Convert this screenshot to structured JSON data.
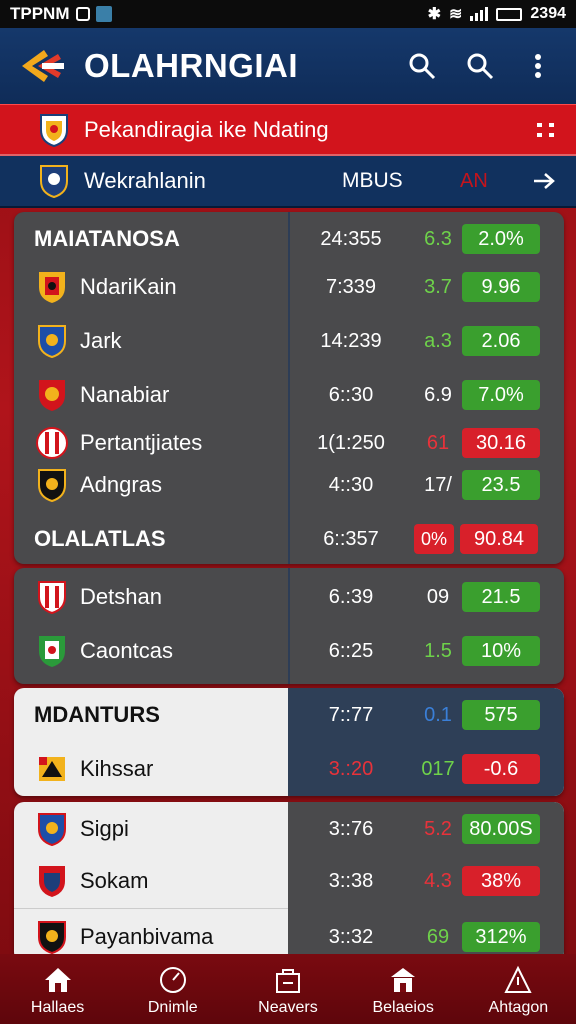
{
  "status_bar": {
    "left_text": "TPPNM",
    "time": "2394"
  },
  "app_bar": {
    "title": "OLAHRNGIAI"
  },
  "banner": {
    "text": "Pekandiragia ike Ndating"
  },
  "sub_banner": {
    "name": "Wekrahlanin",
    "col2": "MBUS",
    "col3": "AN"
  },
  "card1": {
    "heading": {
      "label": "MAIATANOSA",
      "time": "24:355",
      "odds": "6.3",
      "pct": "2.0%"
    },
    "rows": [
      {
        "team": "NdariKain",
        "time": "7:339",
        "odds": "3.7",
        "pct": "9.96"
      },
      {
        "team": "Jark",
        "time": "14:239",
        "odds": "a.3",
        "pct": "2.06"
      },
      {
        "team": "Nanabiar",
        "time": "6::30",
        "odds": "6.9",
        "pct": "7.0%"
      },
      {
        "team": "Pertantjiates",
        "time": "1(1:250",
        "odds": "61",
        "pct": "30.16"
      },
      {
        "team": "Adngras",
        "time": "4::30",
        "odds": "17/",
        "pct": "23.5"
      }
    ],
    "footer": {
      "label": "OLALATLAS",
      "time": "6::357",
      "badge": "0%",
      "pct": "90.84"
    }
  },
  "card2": {
    "rows": [
      {
        "team": "Detshan",
        "time": "6.:39",
        "odds": "09",
        "pct": "21.5"
      },
      {
        "team": "Caontcas",
        "time": "6::25",
        "odds": "1.5",
        "pct": "10%"
      }
    ]
  },
  "card3": {
    "heading": {
      "label": "MDANTURS",
      "time": "7::77",
      "odds": "0.1",
      "pct": "575"
    },
    "rows": [
      {
        "team": "Kihssar",
        "time": "3.:20",
        "odds": "017",
        "pct": "-0.6"
      }
    ]
  },
  "card4": {
    "rows": [
      {
        "team": "Sigpi",
        "time": "3::76",
        "odds": "5.2",
        "pct": "80.00S"
      },
      {
        "team": "Sokam",
        "time": "3::38",
        "odds": "4.3",
        "pct": "38%"
      },
      {
        "team": "Payanbivama",
        "time": "3::32",
        "odds": "69",
        "pct": "312%"
      }
    ]
  },
  "bottom_nav": [
    {
      "label": "Hallaes",
      "icon": "home-icon"
    },
    {
      "label": "Dnimle",
      "icon": "gauge-icon"
    },
    {
      "label": "Neavers",
      "icon": "bag-icon"
    },
    {
      "label": "Belaeios",
      "icon": "building-icon"
    },
    {
      "label": "Ahtagon",
      "icon": "chart-icon"
    }
  ],
  "colors": {
    "green": "#3a9f2e",
    "red": "#d8202a",
    "navy": "#11315e",
    "banner_red": "#d2141c"
  }
}
